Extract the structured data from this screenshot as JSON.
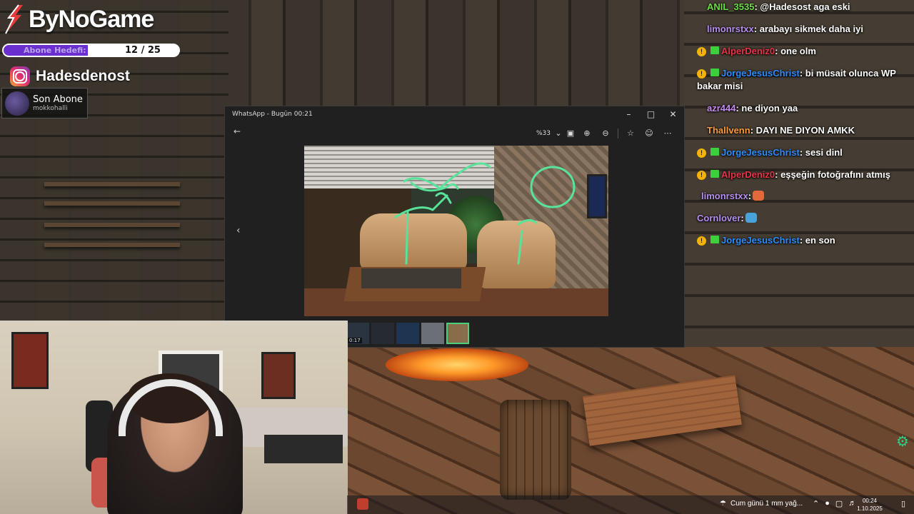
{
  "brand": {
    "name": "ByNoGame"
  },
  "sub_goal": {
    "label": "Abone Hedefi:",
    "count": "12 / 25",
    "progress": 0.48
  },
  "instagram": {
    "handle": "Hadesdenost"
  },
  "last_sub": {
    "title": "Son Abone",
    "user": "mokkohalli"
  },
  "chat": [
    {
      "user": "ANIL_3535",
      "color": "#6fdc4a",
      "text": ": @Hadesost aga eski",
      "badges": []
    },
    {
      "user": "limonrstxx",
      "color": "#b58cf2",
      "text": ": arabayı sikmek daha iyi",
      "badges": []
    },
    {
      "user": "AlperDeniz0",
      "color": "#e8334a",
      "text": ": one olm",
      "badges": [
        "warn",
        "sub"
      ]
    },
    {
      "user": "JorgeJesusChrist",
      "color": "#2e8cff",
      "text": ": bi müsait olunca WP bakar misi",
      "badges": [
        "warn",
        "sub"
      ]
    },
    {
      "user": "azr444",
      "color": "#c78af3",
      "text": ": ne diyon yaa",
      "badges": []
    },
    {
      "user": "Thallvenn",
      "color": "#ff9a3a",
      "text": ": DAYI NE DIYON AMKK",
      "badges": []
    },
    {
      "user": "JorgeJesusChrist",
      "color": "#2e8cff",
      "text": ": sesi dinl",
      "badges": [
        "warn",
        "sub"
      ]
    },
    {
      "user": "AlperDeniz0",
      "color": "#e8334a",
      "text": ": eşşeğin fotoğrafını atmış",
      "badges": [
        "warn",
        "sub"
      ]
    },
    {
      "user": "limonrstxx",
      "color": "#b58cf2",
      "text": ":",
      "badges": [],
      "emote": "#e26a3a"
    },
    {
      "user": "Cornlover",
      "color": "#b58cf2",
      "text": ":",
      "badges": [],
      "emote": "#4aa3d8"
    },
    {
      "user": "JorgeJesusChrist",
      "color": "#2e8cff",
      "text": ": en son",
      "badges": [
        "warn",
        "sub"
      ]
    }
  ],
  "viewer": {
    "title": "WhatsApp - Bugün 00:21",
    "zoom": "%33",
    "thumb_duration": "0:17"
  },
  "taskbar": {
    "weather": "Cum günü 1 mm yağ...",
    "time": "00:24",
    "date": "1.10.2025"
  },
  "colors": {
    "accent_green": "#4ad07b",
    "sub_goal_fill": "#6b2fd0"
  }
}
